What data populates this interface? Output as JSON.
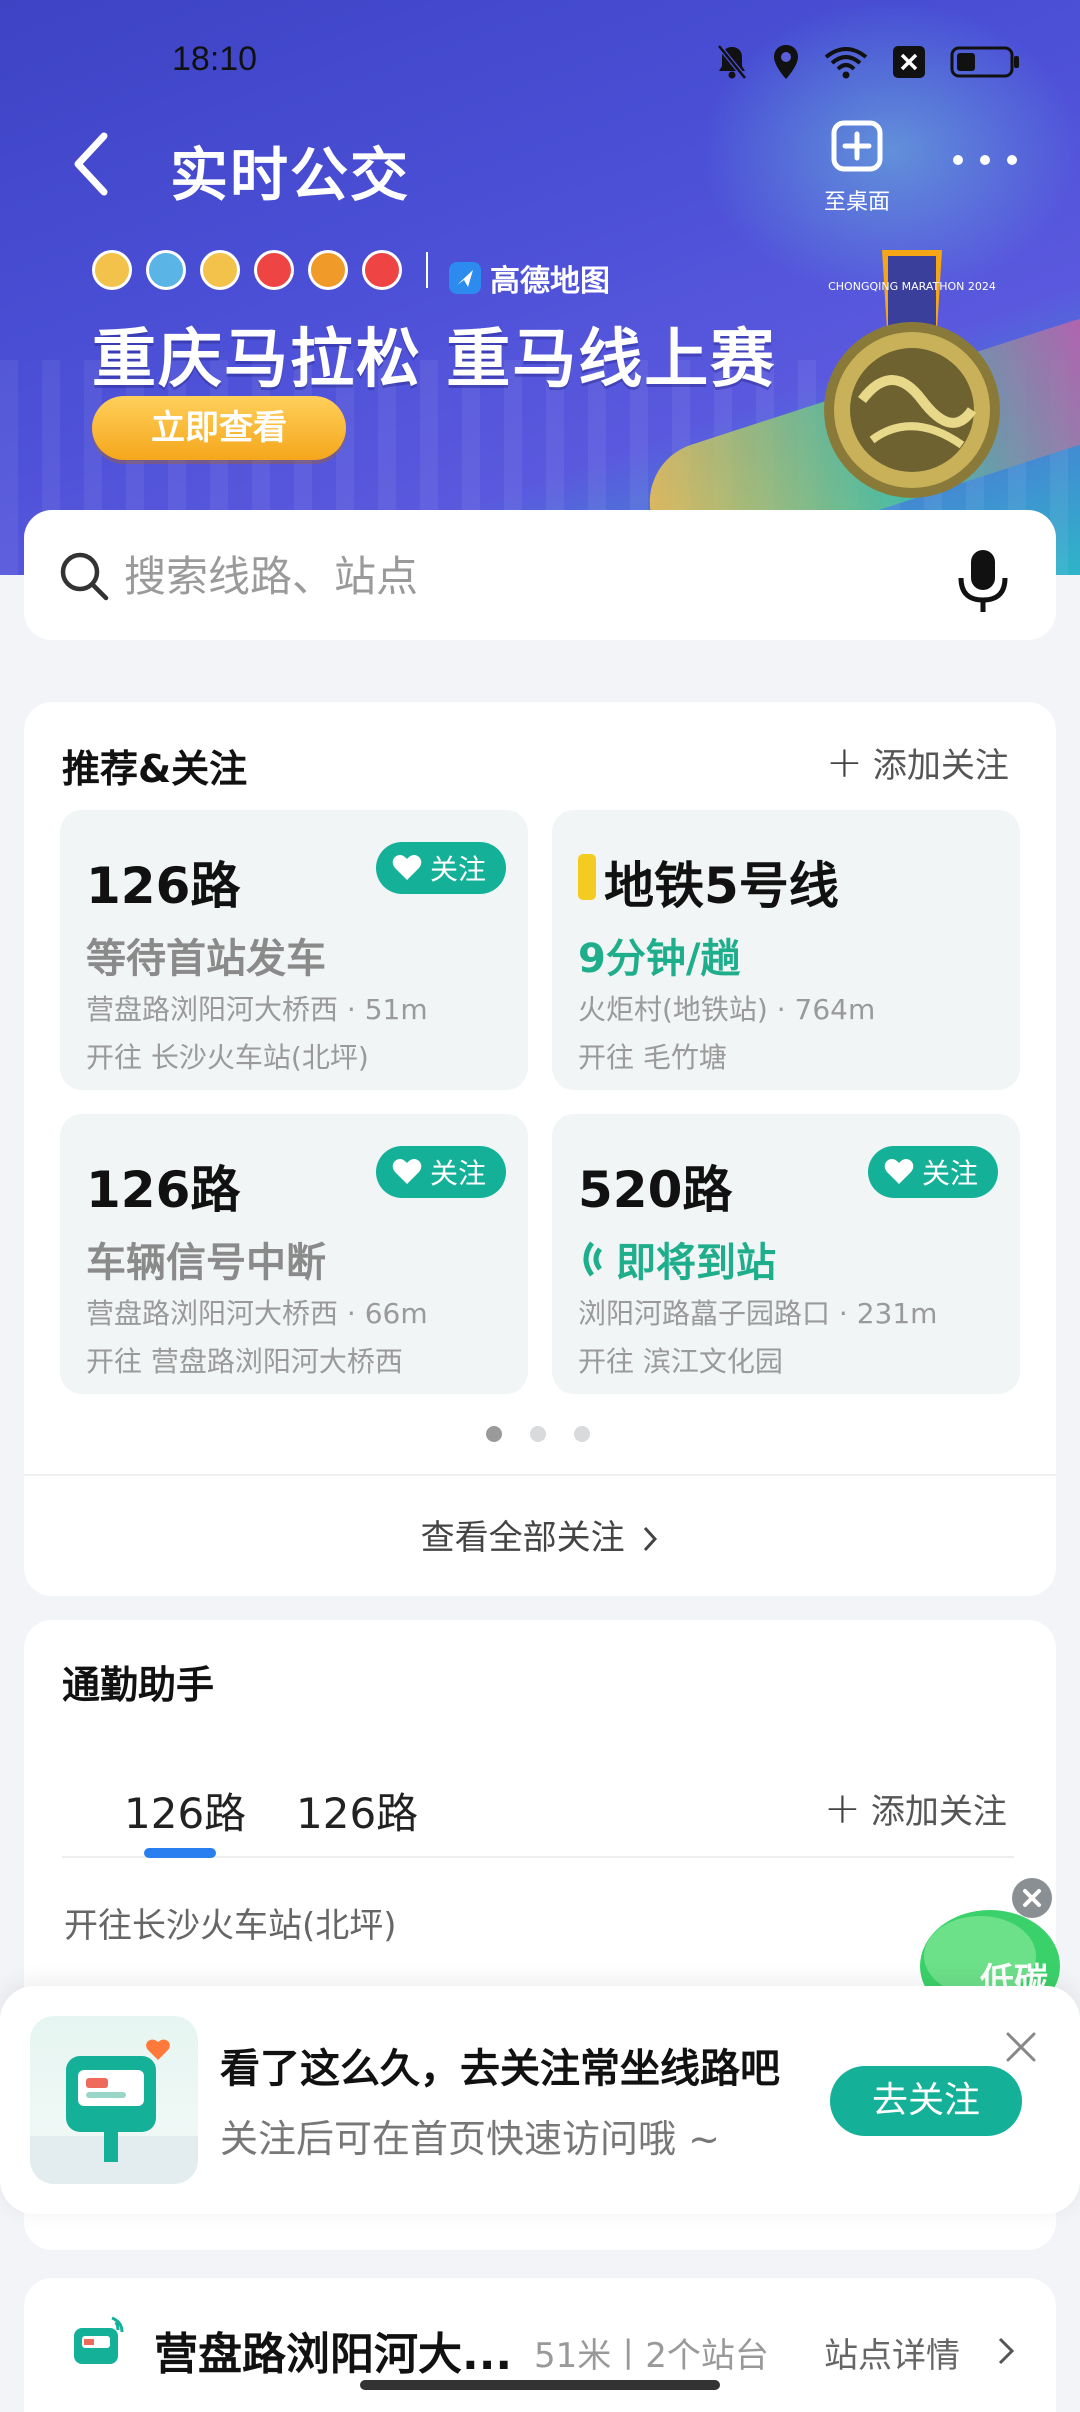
{
  "status_bar": {
    "time": "18:10"
  },
  "header": {
    "title": "实时公交",
    "add_desktop_label": "至桌面"
  },
  "banner": {
    "brand": "高德地图",
    "title": "重庆马拉松 重马线上赛",
    "button": "立即查看",
    "medal_text": "CHONGQING MARATHON 2024"
  },
  "search": {
    "placeholder": "搜索线路、站点"
  },
  "recommend": {
    "title": "推荐&关注",
    "add_follow": "添加关注",
    "follow_label": "关注",
    "tiles": [
      {
        "route": "126路",
        "status": "等待首站发车",
        "stop": "营盘路浏阳河大桥西 · 51m",
        "direction": "开往 长沙火车站(北坪)",
        "followed": true
      },
      {
        "route": "地铁5号线",
        "status": "9分钟/趟",
        "stop": "火炬村(地铁站) · 764m",
        "direction": "开往 毛竹塘",
        "followed": false
      },
      {
        "route": "126路",
        "status": "车辆信号中断",
        "stop": "营盘路浏阳河大桥西 · 66m",
        "direction": "开往 营盘路浏阳河大桥西",
        "followed": true
      },
      {
        "route": "520路",
        "status": "即将到站",
        "stop": "浏阳河路藠子园路口 · 231m",
        "direction": "开往 滨江文化园",
        "followed": true
      }
    ],
    "view_all": "查看全部关注"
  },
  "commute": {
    "title": "通勤助手",
    "tabs": [
      "126路",
      "126路"
    ],
    "add_follow": "添加关注",
    "direction": "开往长沙火车站(北坪)",
    "eco_label": "低碳"
  },
  "prompt": {
    "title": "看了这么久，去关注常坐线路吧",
    "subtitle": "关注后可在首页快速访问哦 ~",
    "button": "去关注"
  },
  "station": {
    "name": "营盘路浏阳河大...",
    "meta": "51米丨2个站台",
    "detail": "站点详情"
  },
  "colors": {
    "accent_green": "#14b198",
    "header_blue": "#4a4fd6",
    "metro_yellow": "#f4cb20"
  }
}
